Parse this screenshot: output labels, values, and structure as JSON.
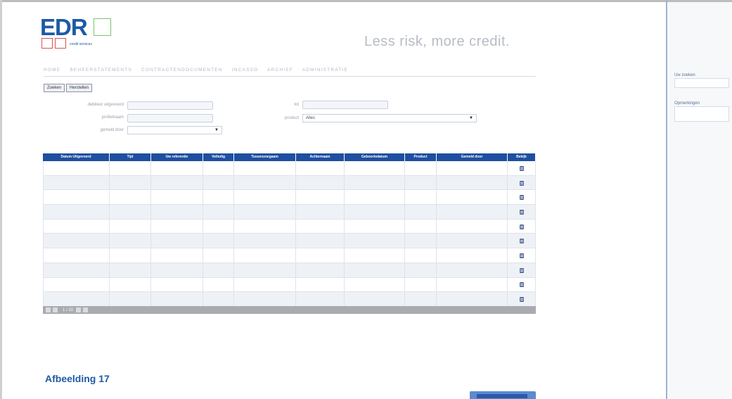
{
  "brand": {
    "logo_text": "EDR",
    "logo_subtext": "credit services",
    "tagline": "Less risk, more credit."
  },
  "nav": {
    "items": [
      "HOME",
      "BEHEERSTATEMENTS",
      "CONTRACTENDOCUMENTEN",
      "INCASSO",
      "ARCHIEF",
      "ADMINISTRATIE"
    ]
  },
  "toolbar": {
    "search_label": "Zoeken",
    "reset_label": "Herstellen"
  },
  "form": {
    "left_labels": [
      "debiteur uitgevoerd",
      "profielnaam",
      "gemeld door"
    ],
    "right_labels": [
      "tot",
      "product"
    ],
    "product_value": "Alles"
  },
  "grid": {
    "columns": [
      "Datum Uitgevoerd",
      "Tijd",
      "Uw referentie",
      "Volledig",
      "Tussenzoegaam",
      "Achternaam",
      "Geboortedatum",
      "Product",
      "Gemeld door",
      "Bekijk"
    ],
    "row_count": 10
  },
  "pager": {
    "page_text": "1 / 10"
  },
  "right_panel": {
    "field1_label": "Uw zoeken",
    "field2_label": "Opmerkingen"
  },
  "caption": "Afbeelding 17",
  "colors": {
    "brand_blue": "#1d5aa5",
    "grid_header": "#1e4fa0",
    "logo_green": "#7ec26e",
    "logo_red": "#d9534f"
  }
}
